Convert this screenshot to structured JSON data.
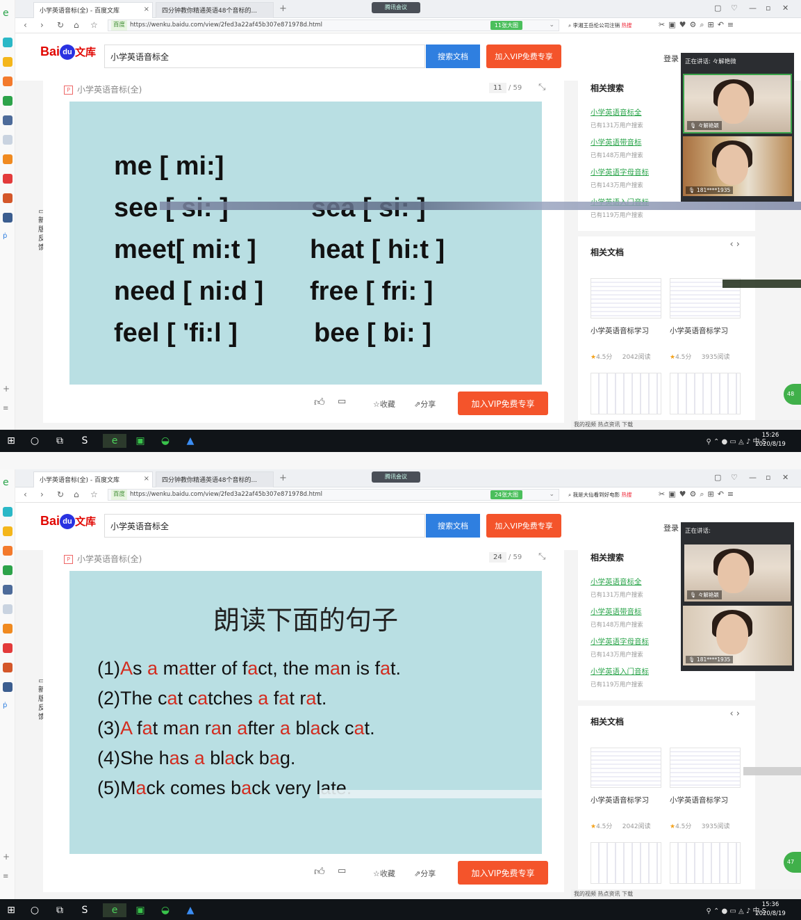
{
  "screens": [
    {
      "tabs": [
        {
          "title": "小学英语音标(全) - 百度文库"
        },
        {
          "title": "四分钟教你精通英语48个音标的..."
        }
      ],
      "meeting_label": "腾讯会议",
      "url": "https://wenku.baidu.com/view/2fed3a22af45b307e871978d.html",
      "url_tag": "百度",
      "url_badge": "11张大图",
      "mini_search": "李湘王岳伦公司注销",
      "mini_search_hot": "热搜",
      "search_value": "小学英语音标全",
      "search_button": "搜索文档",
      "vip_button": "加入VIP免费专享",
      "login": "登录",
      "doc_title": "小学英语音标(全)",
      "page_current": "11",
      "page_total": "/ 59",
      "slide": {
        "lines": [
          {
            "text": "me  [ mi:]"
          },
          {
            "text": "see  [ si: ]"
          },
          {
            "text": "sea  [ si: ]"
          },
          {
            "text": "meet[ mi:t ]"
          },
          {
            "text": "heat  [ hi:t ]"
          },
          {
            "text": "need [ ni:d ]"
          },
          {
            "text": "free  [ fri: ]"
          },
          {
            "text": "feel  [ 'fi:l ]"
          },
          {
            "text": "bee [ bi: ]"
          }
        ]
      },
      "footer": {
        "collect": "收藏",
        "share": "分享",
        "vip": "加入VIP免费专享"
      },
      "related_search": {
        "title": "相关搜索",
        "items": [
          {
            "link": "小学英语音标全",
            "sub": "已有131万用户搜索"
          },
          {
            "link": "小学英语带音标",
            "sub": "已有148万用户搜索"
          },
          {
            "link": "小学英语字母音标",
            "sub": "已有143万用户搜索"
          },
          {
            "link": "小学英语入门音标",
            "sub": "已有119万用户搜索"
          }
        ]
      },
      "related_docs": {
        "title": "相关文档",
        "items": [
          {
            "caption": "小学英语音标学习",
            "rating": "4.5分",
            "reads": "2042阅读"
          },
          {
            "caption": "小学英语音标学习",
            "rating": "4.5分",
            "reads": "3935阅读"
          }
        ]
      },
      "call": {
        "speaking": "正在讲话: 々解艳微",
        "user1": "々解艳颖",
        "user2": "181****1935"
      },
      "statusbar": "我的视频  热点资讯   下载",
      "clock_time": "15:26",
      "clock_date": "2020/8/19",
      "feedback": "新版反馈",
      "bubble": "48"
    },
    {
      "tabs": [
        {
          "title": "小学英语音标(全) - 百度文库"
        },
        {
          "title": "四分钟教你精通英语48个音标的..."
        }
      ],
      "meeting_label": "腾讯会议",
      "url": "https://wenku.baidu.com/view/2fed3a22af45b307e871978d.html",
      "url_tag": "百度",
      "url_badge": "24张大图",
      "mini_search": "我是大仙看到好电影",
      "mini_search_hot": "热搜",
      "search_value": "小学英语音标全",
      "search_button": "搜索文档",
      "vip_button": "加入VIP免费专享",
      "login": "登录",
      "doc_title": "小学英语音标(全)",
      "page_current": "24",
      "page_total": "/ 59",
      "slide": {
        "heading": "朗读下面的句子",
        "sentences": [
          {
            "text": "(1)As a matter of fact, the man is fat."
          },
          {
            "text": "(2)The cat catches a fat rat."
          },
          {
            "text": "(3)A fat man ran after a black cat."
          },
          {
            "text": "(4)She has a black bag."
          },
          {
            "text": "(5)Mack comes back very late."
          }
        ]
      },
      "footer": {
        "collect": "收藏",
        "share": "分享",
        "vip": "加入VIP免费专享"
      },
      "related_search": {
        "title": "相关搜索",
        "items": [
          {
            "link": "小学英语音标全",
            "sub": "已有131万用户搜索"
          },
          {
            "link": "小学英语带音标",
            "sub": "已有148万用户搜索"
          },
          {
            "link": "小学英语字母音标",
            "sub": "已有143万用户搜索"
          },
          {
            "link": "小学英语入门音标",
            "sub": "已有119万用户搜索"
          }
        ]
      },
      "related_docs": {
        "title": "相关文档",
        "items": [
          {
            "caption": "小学英语音标学习",
            "rating": "4.5分",
            "reads": "2042阅读"
          },
          {
            "caption": "小学英语音标学习",
            "rating": "4.5分",
            "reads": "3935阅读"
          }
        ]
      },
      "call": {
        "speaking": "正在讲话:",
        "user1": "々解艳颖",
        "user2": "181****1935"
      },
      "statusbar": "我的视频  热点资讯   下载",
      "clock_time": "15:36",
      "clock_date": "2020/8/19",
      "feedback": "新版反馈",
      "bubble": "47"
    }
  ],
  "theme": {
    "accent_blue": "#2f7fe0",
    "vip_orange": "#f4542b",
    "slide_bg": "#b9dfe3",
    "link_green": "#2aa44a",
    "highlight_red": "#d32c1f"
  }
}
